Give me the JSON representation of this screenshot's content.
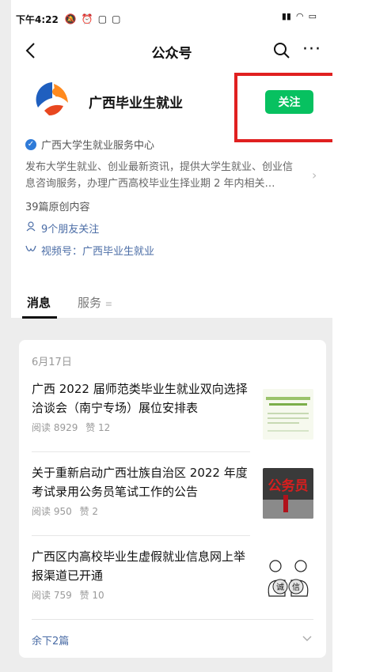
{
  "statusbar": {
    "time": "下午4:22",
    "icons": [
      "mute-icon",
      "alarm-icon",
      "app-icon",
      "app-icon"
    ],
    "right_icons": [
      "hd-signal-icon",
      "wifi-icon",
      "battery-icon"
    ]
  },
  "navbar": {
    "title": "公众号",
    "back_icon": "back-chevron-icon",
    "search_icon": "search-icon",
    "more_icon": "more-dots-icon"
  },
  "account": {
    "name": "广西毕业生就业",
    "follow_label": "关注",
    "verified_by": "广西大学生就业服务中心",
    "description": "发布大学生就业、创业最新资讯，提供大学生就业、创业信息咨询服务，办理广西高校毕业生择业期 2 年内相关…",
    "original_count": "39篇原创内容",
    "friends_following": "9个朋友关注",
    "video_channel": "视频号：广西毕业生就业"
  },
  "tabs": [
    {
      "label": "消息",
      "active": true
    },
    {
      "label": "服务",
      "active": false
    }
  ],
  "messages": {
    "date": "6月17日",
    "articles": [
      {
        "title": "广西 2022 届师范类毕业生就业双向选择洽谈会（南宁专场）展位安排表",
        "reads": "阅读 8929",
        "likes": "赞 12"
      },
      {
        "title": "关于重新启动广西壮族自治区 2022 年度考试录用公务员笔试工作的公告",
        "reads": "阅读 950",
        "likes": "赞 2"
      },
      {
        "title": "广西区内高校毕业生虚假就业信息网上举报渠道已开通",
        "reads": "阅读 759",
        "likes": "赞 10"
      }
    ],
    "thumb2_text": "公务员",
    "thumb3_text": [
      "诚",
      "信"
    ],
    "remaining": "余下2篇"
  },
  "colors": {
    "follow_green": "#07c160",
    "link_blue": "#4b6da6",
    "highlight_red": "#e02020",
    "verify_blue": "#2f7bd8"
  }
}
